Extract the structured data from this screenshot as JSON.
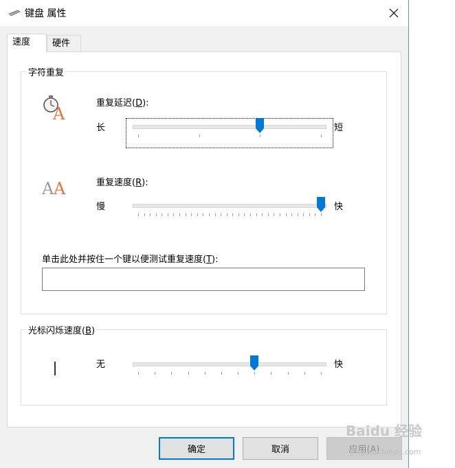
{
  "window": {
    "title": "键盘 属性"
  },
  "tabs": [
    {
      "label": "速度",
      "active": true
    },
    {
      "label": "硬件",
      "active": false
    }
  ],
  "repeat_group": {
    "title": "字符重复",
    "delay": {
      "label_prefix": "重复延迟(",
      "label_key": "D",
      "label_suffix": "):",
      "min_label": "长",
      "max_label": "短",
      "position_fraction": 0.667,
      "tick_count": 4
    },
    "rate": {
      "label_prefix": "重复速度(",
      "label_key": "R",
      "label_suffix": "):",
      "min_label": "慢",
      "max_label": "快",
      "position_fraction": 1.0,
      "tick_count": 32
    },
    "test": {
      "label_prefix": "单击此处并按住一个键以便测试重复速度(",
      "label_key": "T",
      "label_suffix": "):",
      "value": ""
    }
  },
  "blink_group": {
    "title_prefix": "光标闪烁速度(",
    "title_key": "B",
    "title_suffix": ")",
    "min_label": "无",
    "max_label": "快",
    "position_fraction": 0.636,
    "tick_count": 12
  },
  "buttons": {
    "ok": "确定",
    "cancel": "取消",
    "apply": "应用(A)"
  },
  "watermark": {
    "text": "Baidu 经验",
    "sub": "jingyan.baidu.com"
  },
  "colors": {
    "accent": "#0078d7",
    "letter_orange": "#e8733a",
    "letter_gray": "#9a9a9a"
  }
}
